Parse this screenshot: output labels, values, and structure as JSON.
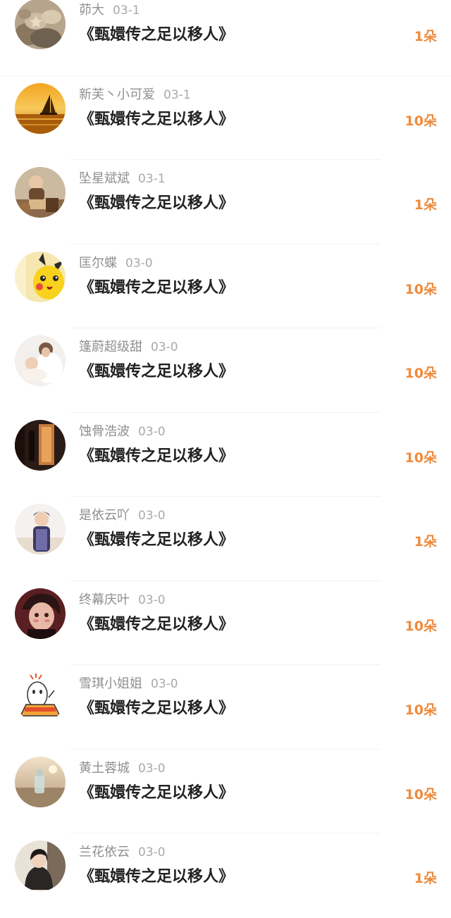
{
  "colors": {
    "accent": "#ef8a3c",
    "meta_text": "#8f8f8f",
    "title_text": "#222222"
  },
  "gifts": [
    {
      "name": "茆大",
      "date": "03-1",
      "book": "《甄嬛传之足以移人》",
      "amount": "1朵",
      "avatar_icon": "pebbles-avatar"
    },
    {
      "name": "新芙丶小可爱",
      "date": "03-1",
      "book": "《甄嬛传之足以移人》",
      "amount": "10朵",
      "avatar_icon": "sailboat-sunset-avatar"
    },
    {
      "name": "坠星斌斌",
      "date": "03-1",
      "book": "《甄嬛传之足以移人》",
      "amount": "1朵",
      "avatar_icon": "baby-photo-avatar"
    },
    {
      "name": "匡尔蝶",
      "date": "03-0",
      "book": "《甄嬛传之足以移人》",
      "amount": "10朵",
      "avatar_icon": "pikachu-avatar"
    },
    {
      "name": "篷蔚超级甜",
      "date": "03-0",
      "book": "《甄嬛传之足以移人》",
      "amount": "10朵",
      "avatar_icon": "mother-child-avatar"
    },
    {
      "name": "蚀骨浩波",
      "date": "03-0",
      "book": "《甄嬛传之足以移人》",
      "amount": "10朵",
      "avatar_icon": "dark-doorway-avatar"
    },
    {
      "name": "是依云吖",
      "date": "03-0",
      "book": "《甄嬛传之足以移人》",
      "amount": "1朵",
      "avatar_icon": "young-man-avatar"
    },
    {
      "name": "终幕庆叶",
      "date": "03-0",
      "book": "《甄嬛传之足以移人》",
      "amount": "10朵",
      "avatar_icon": "anime-boy-avatar"
    },
    {
      "name": "雪琪小姐姐",
      "date": "03-0",
      "book": "《甄嬛传之足以移人》",
      "amount": "10朵",
      "avatar_icon": "cartoon-character-avatar"
    },
    {
      "name": "黄土蓉城",
      "date": "03-0",
      "book": "《甄嬛传之足以移人》",
      "amount": "10朵",
      "avatar_icon": "bottle-beach-avatar"
    },
    {
      "name": "兰花依云",
      "date": "03-0",
      "book": "《甄嬛传之足以移人》",
      "amount": "1朵",
      "avatar_icon": "woman-portrait-avatar"
    }
  ]
}
